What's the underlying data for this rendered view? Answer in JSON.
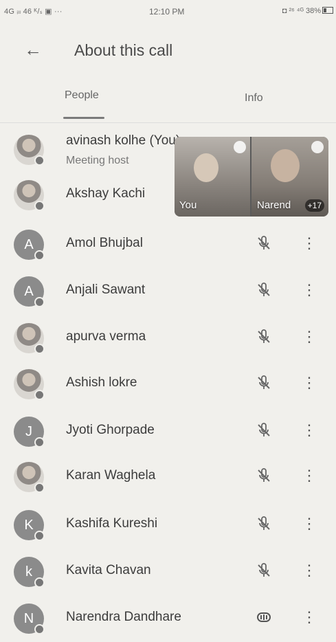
{
  "status_bar": {
    "left": "4G ᵢₗₗ 46 ᴷ/ₛ ▣ ···",
    "time": "12:10 PM",
    "right": "◘ ²⁶ ⁴ᴳ 38%"
  },
  "app_bar": {
    "title": "About this call"
  },
  "tabs": [
    {
      "label": "People"
    },
    {
      "label": "Info"
    }
  ],
  "video_strip": {
    "you_label": "You",
    "remote_label": "Narend",
    "more_count": "+17"
  },
  "participants": [
    {
      "name": "avinash kolhe (You)",
      "subtitle": "Meeting host",
      "avatar_letter": "",
      "photo": true,
      "mic_icon": "",
      "show_actions": false
    },
    {
      "name": "Akshay Kachi",
      "subtitle": "",
      "avatar_letter": "",
      "photo": true,
      "mic_icon": "",
      "show_actions": false
    },
    {
      "name": "Amol Bhujbal",
      "subtitle": "",
      "avatar_letter": "A",
      "photo": false,
      "mic_icon": "mic-off-icon",
      "show_actions": true
    },
    {
      "name": "Anjali Sawant",
      "subtitle": "",
      "avatar_letter": "A",
      "photo": false,
      "mic_icon": "mic-off-icon",
      "show_actions": true
    },
    {
      "name": "apurva verma",
      "subtitle": "",
      "avatar_letter": "",
      "photo": true,
      "mic_icon": "mic-off-icon",
      "show_actions": true
    },
    {
      "name": "Ashish lokre",
      "subtitle": "",
      "avatar_letter": "",
      "photo": true,
      "mic_icon": "mic-off-icon",
      "show_actions": true
    },
    {
      "name": "Jyoti Ghorpade",
      "subtitle": "",
      "avatar_letter": "J",
      "photo": false,
      "mic_icon": "mic-off-icon",
      "show_actions": true
    },
    {
      "name": "Karan Waghela",
      "subtitle": "",
      "avatar_letter": "",
      "photo": true,
      "mic_icon": "mic-off-icon",
      "show_actions": true
    },
    {
      "name": "Kashifa Kureshi",
      "subtitle": "",
      "avatar_letter": "K",
      "photo": false,
      "mic_icon": "mic-off-icon",
      "show_actions": true
    },
    {
      "name": "Kavita Chavan",
      "subtitle": "",
      "avatar_letter": "k",
      "photo": false,
      "mic_icon": "mic-off-icon",
      "show_actions": true
    },
    {
      "name": "Narendra Dandhare",
      "subtitle": "",
      "avatar_letter": "N",
      "photo": false,
      "mic_icon": "speaking-icon",
      "show_actions": true
    }
  ]
}
